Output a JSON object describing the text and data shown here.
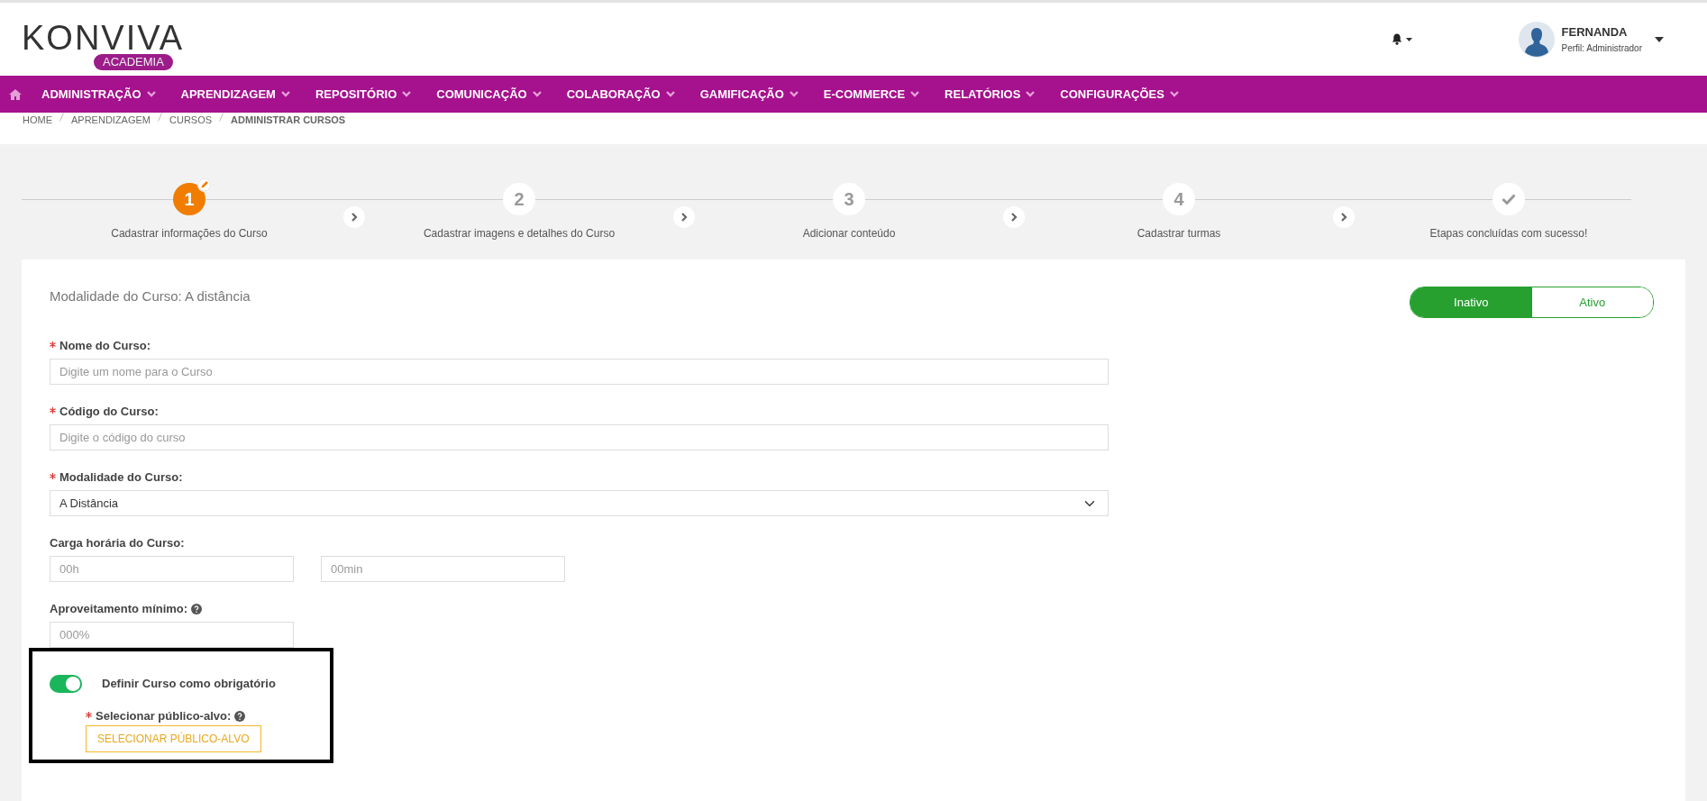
{
  "header": {
    "logo": {
      "wordmark": "KONVIVA",
      "badge": "ACADEMIA"
    },
    "user": {
      "name": "FERNANDA",
      "profile": "Perfil: Administrador"
    }
  },
  "nav": {
    "items": [
      {
        "label": "ADMINISTRAÇÃO"
      },
      {
        "label": "APRENDIZAGEM"
      },
      {
        "label": "REPOSITÓRIO"
      },
      {
        "label": "COMUNICAÇÃO"
      },
      {
        "label": "COLABORAÇÃO"
      },
      {
        "label": "GAMIFICAÇÃO"
      },
      {
        "label": "E-COMMERCE"
      },
      {
        "label": "RELATÓRIOS"
      },
      {
        "label": "CONFIGURAÇÕES"
      }
    ]
  },
  "breadcrumb": [
    {
      "label": "HOME",
      "current": false
    },
    {
      "label": "APRENDIZAGEM",
      "current": false
    },
    {
      "label": "CURSOS",
      "current": false
    },
    {
      "label": "ADMINISTRAR CURSOS",
      "current": true
    }
  ],
  "steps": [
    {
      "kind": "number",
      "number": "1",
      "label": "Cadastrar informações do Curso",
      "selected": true
    },
    {
      "kind": "number",
      "number": "2",
      "label": "Cadastrar imagens e detalhes do Curso",
      "selected": false
    },
    {
      "kind": "number",
      "number": "3",
      "label": "Adicionar conteúdo",
      "selected": false
    },
    {
      "kind": "number",
      "number": "4",
      "label": "Cadastrar turmas",
      "selected": false
    },
    {
      "kind": "check",
      "label": "Etapas concluídas com sucesso!",
      "selected": false
    }
  ],
  "form": {
    "title": "Modalidade do Curso: A distância",
    "status_toggle": [
      {
        "label": "Inativo",
        "selected": true
      },
      {
        "label": "Ativo",
        "selected": false
      }
    ],
    "fields": [
      {
        "kind": "text",
        "label": "Nome do Curso:",
        "required": true,
        "help": false,
        "placeholder": "Digite um nome para o Curso"
      },
      {
        "kind": "text",
        "label": "Código do Curso:",
        "required": true,
        "help": false,
        "placeholder": "Digite o código do curso"
      },
      {
        "kind": "select",
        "label": "Modalidade do Curso:",
        "required": true,
        "help": false,
        "value": "A Distância"
      },
      {
        "kind": "pair",
        "label": "Carga horária do Curso:",
        "required": false,
        "help": false,
        "inputs": [
          {
            "placeholder": "00h"
          },
          {
            "placeholder": "00min"
          }
        ]
      },
      {
        "kind": "short",
        "label": "Aproveitamento mínimo:",
        "required": false,
        "help": true,
        "placeholder": "000%"
      }
    ],
    "mandatory": {
      "on": true,
      "label": "Definir Curso como obrigatório",
      "audience_label": "Selecionar público-alvo:",
      "audience_required": true,
      "audience_help": true,
      "button": "SELECIONAR PÚBLICO-ALVO"
    }
  }
}
